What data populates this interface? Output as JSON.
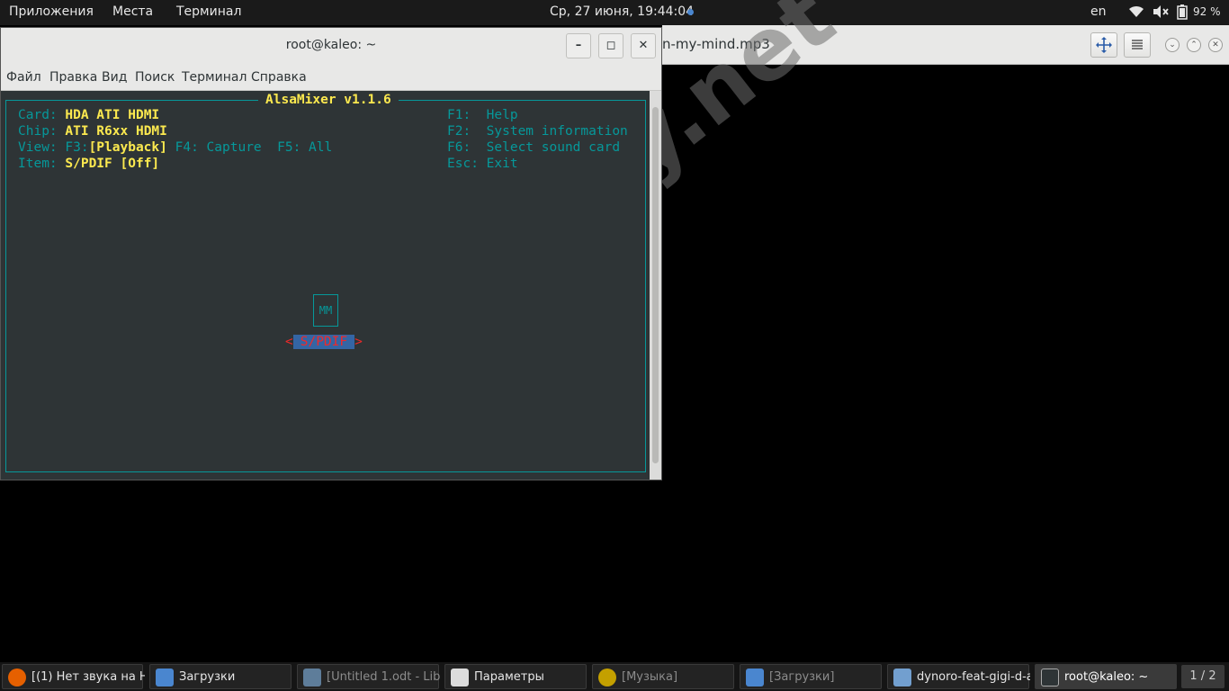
{
  "top_panel": {
    "apps_menu": "Приложения",
    "places_menu": "Места",
    "terminal_menu": "Терминал",
    "clock": "Ср, 27 июня, 19:44:04",
    "keyboard_layout": "en",
    "battery_percent": "92 %"
  },
  "background_window": {
    "title": "n-my-mind.mp3"
  },
  "terminal": {
    "title": "root@kaleo: ~",
    "menu": [
      "Файл",
      "Правка",
      "Вид",
      "Поиск",
      "Терминал",
      "Справка"
    ],
    "alsamixer": {
      "title": "AlsaMixer v1.1.6",
      "card_label": "Card: ",
      "card_value": "HDA ATI HDMI",
      "chip_label": "Chip: ",
      "chip_value": "ATI R6xx HDMI",
      "view_label": "View: F3:",
      "view_value": "[Playback]",
      "view_rest": " F4: Capture  F5: All",
      "item_label": "Item: ",
      "item_value": "S/PDIF [Off]",
      "help_f1": "F1:  Help",
      "help_f2": "F2:  System information",
      "help_f6": "F6:  Select sound card",
      "help_esc": "Esc: Exit",
      "control_box": "MM",
      "control_left": "<",
      "control_name": "S/PDIF",
      "control_right": ">"
    }
  },
  "watermark": "codeby.net",
  "taskbar": {
    "tasks": [
      {
        "label": "[(1) Нет звука на Н...",
        "icon": "firefox-icon",
        "color": "#e66000"
      },
      {
        "label": "Загрузки",
        "icon": "files-icon",
        "color": "#4a86cf"
      },
      {
        "label": "[Untitled 1.odt - Lib...",
        "icon": "document-icon",
        "color": "#5e7d9a"
      },
      {
        "label": "Параметры",
        "icon": "settings-icon",
        "color": "#dcdcdc"
      },
      {
        "label": "[Музыка]",
        "icon": "music-icon",
        "color": "#c4a000"
      },
      {
        "label": "[Загрузки]",
        "icon": "files-icon",
        "color": "#4a86cf"
      },
      {
        "label": "dynoro-feat-gigi-d-a...",
        "icon": "media-player-icon",
        "color": "#729fcf"
      },
      {
        "label": "root@kaleo: ~",
        "icon": "terminal-icon",
        "color": "#2e3436"
      }
    ],
    "workspace": "1 / 2"
  }
}
